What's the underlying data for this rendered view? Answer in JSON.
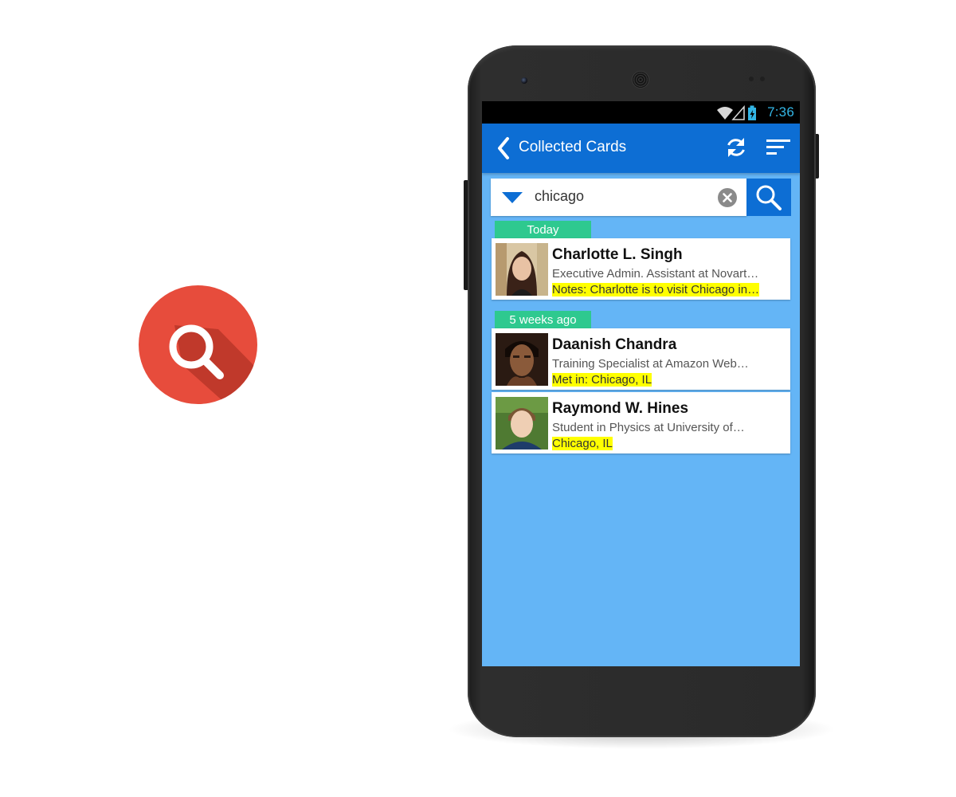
{
  "colors": {
    "badge": "#e74c3c",
    "appbar": "#0d6ed4",
    "screen_bg": "#64b5f6",
    "section_tag": "#2ec98f",
    "highlight": "#ffff00",
    "status_text": "#33b5e5"
  },
  "badge": {
    "icon": "search-icon"
  },
  "status_bar": {
    "time": "7:36",
    "icons": [
      "wifi-icon",
      "signal-icon",
      "battery-charging-icon"
    ]
  },
  "app_bar": {
    "title": "Collected Cards",
    "back_icon": "chevron-left-icon",
    "actions": [
      "refresh-icon",
      "sort-icon"
    ]
  },
  "search": {
    "filter_icon": "triangle-down-icon",
    "query": "chicago",
    "clear_icon": "clear-icon",
    "button_icon": "search-icon"
  },
  "sections": [
    {
      "label": "Today",
      "cards": [
        {
          "name": "Charlotte L. Singh",
          "title": "Executive Admin. Assistant at Novart…",
          "note": "Notes: Charlotte is to visit Chicago in…"
        }
      ]
    },
    {
      "label": "5 weeks ago",
      "cards": [
        {
          "name": "Daanish Chandra",
          "title": "Training Specialist at Amazon Web…",
          "note": "Met in: Chicago, IL"
        },
        {
          "name": "Raymond W. Hines",
          "title": "Student in Physics at University of…",
          "note": "Chicago, IL"
        }
      ]
    }
  ]
}
